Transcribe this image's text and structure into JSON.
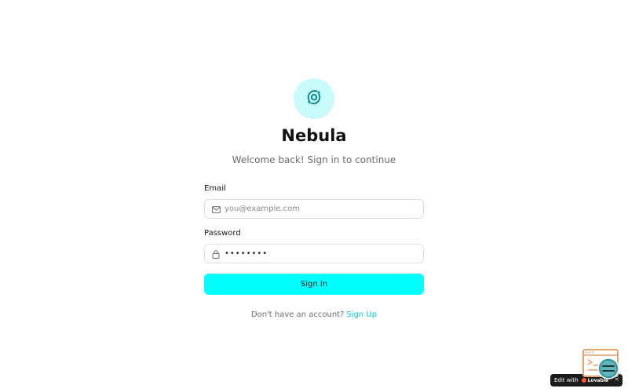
{
  "app": {
    "title": "Nebula",
    "subtitle": "Welcome back! Sign in to continue",
    "logo_icon": "orbit-icon"
  },
  "form": {
    "email_label": "Email",
    "email_placeholder": "you@example.com",
    "email_icon": "mail-icon",
    "password_label": "Password",
    "password_value": "••••••••",
    "password_icon": "lock-icon",
    "submit_label": "Sign In"
  },
  "footer": {
    "prompt": "Don't have an account?",
    "signup_label": "Sign Up"
  },
  "badge": {
    "edit_with": "Edit with",
    "brand": "Lovable",
    "close": "×"
  },
  "colors": {
    "accent": "#00ffff",
    "logo_bg": "#c9fbfc",
    "link": "#00c8d4"
  }
}
